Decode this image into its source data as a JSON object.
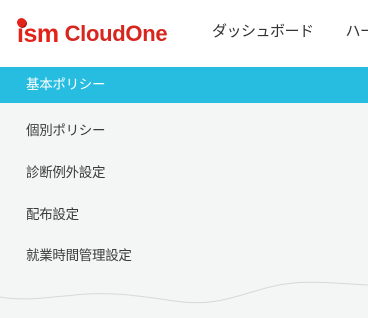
{
  "header": {
    "logo": {
      "brand_prefix": "ism",
      "brand_name": "CloudOne",
      "brand_color": "#e2231a"
    },
    "nav": [
      {
        "label": "ダッシュボード"
      },
      {
        "label": "ハー"
      }
    ]
  },
  "sidebar": {
    "accent_color": "#27bde0",
    "items": [
      {
        "label": "基本ポリシー",
        "active": true
      },
      {
        "label": "個別ポリシー",
        "active": false
      },
      {
        "label": "診断例外設定",
        "active": false
      },
      {
        "label": "配布設定",
        "active": false
      },
      {
        "label": "就業時間管理設定",
        "active": false
      }
    ]
  }
}
